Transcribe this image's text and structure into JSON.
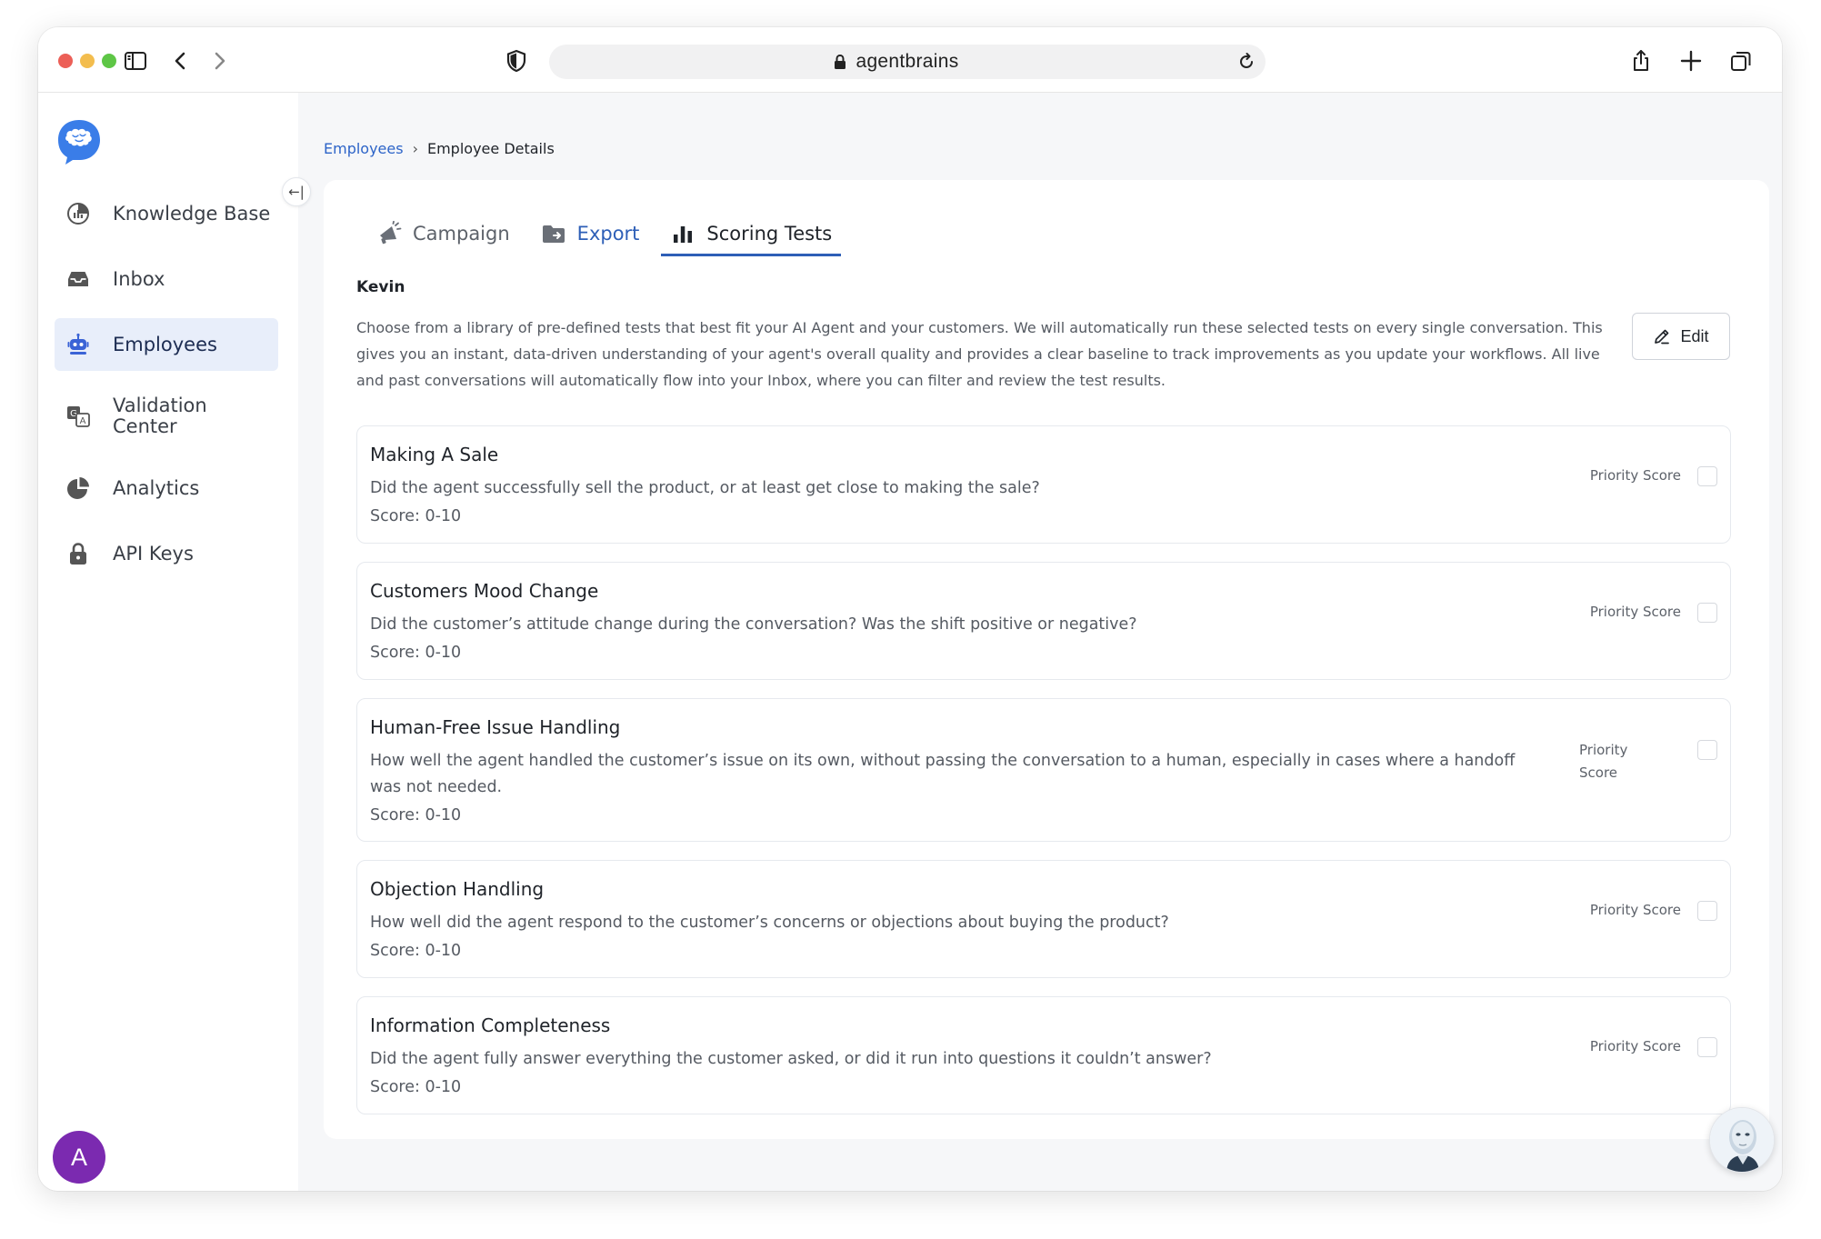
{
  "browser": {
    "url": "agentbrains",
    "controls": [
      "sidebar-toggle-icon",
      "back-icon",
      "forward-icon",
      "shield-icon",
      "lock-icon",
      "reload-icon",
      "share-icon",
      "new-tab-icon",
      "tabs-icon"
    ]
  },
  "sidebar": {
    "items": [
      {
        "label": "Knowledge Base",
        "icon": "knowledge-base-icon"
      },
      {
        "label": "Inbox",
        "icon": "inbox-icon"
      },
      {
        "label": "Employees",
        "icon": "robot-icon",
        "active": true
      },
      {
        "label": "Validation\nCenter",
        "icon": "translate-icon"
      },
      {
        "label": "Analytics",
        "icon": "pie-chart-icon"
      },
      {
        "label": "API Keys",
        "icon": "lock-icon"
      }
    ],
    "avatar_initial": "A",
    "collapse_glyph": "←|"
  },
  "breadcrumb": {
    "parent": "Employees",
    "separator": "›",
    "current": "Employee Details"
  },
  "tabs": [
    {
      "label": "Campaign",
      "icon": "megaphone-icon"
    },
    {
      "label": "Export",
      "icon": "folder-export-icon"
    },
    {
      "label": "Scoring Tests",
      "icon": "bar-chart-icon",
      "active": true
    }
  ],
  "agent": {
    "name": "Kevin",
    "description": "Choose from a library of pre-defined tests that best fit your AI Agent and your customers. We will automatically run these selected tests on every single conversation. This gives you an instant, data-driven understanding of your agent's overall quality and provides a clear baseline to track improvements as you update your workflows. All live and past conversations will automatically flow into your Inbox, where you can filter and review the test results."
  },
  "edit_label": "Edit",
  "priority_label": "Priority Score",
  "tests": [
    {
      "title": "Making A Sale",
      "description": "Did the agent successfully sell the product, or at least get close to making the sale?",
      "score": "Score: 0-10"
    },
    {
      "title": "Customers Mood Change",
      "description": "Did the customer’s attitude change during the conversation? Was the shift positive or negative?",
      "score": "Score: 0-10"
    },
    {
      "title": "Human-Free Issue Handling",
      "description": "How well the agent handled the customer’s issue on its own, without passing the conversation to a human, especially in cases where a handoff was not needed.",
      "score": "Score: 0-10"
    },
    {
      "title": "Objection Handling",
      "description": "How well did the agent respond to the customer’s concerns or objections about buying the product?",
      "score": "Score: 0-10"
    },
    {
      "title": "Information Completeness",
      "description": "Did the agent fully answer everything the customer asked, or did it run into questions it couldn’t answer?",
      "score": "Score: 0-10"
    }
  ],
  "colors": {
    "accent": "#2e5fb7",
    "active_nav_bg": "#e8eefa",
    "avatar_bg": "#7b2ab0",
    "page_bg": "#f6f7f9"
  }
}
